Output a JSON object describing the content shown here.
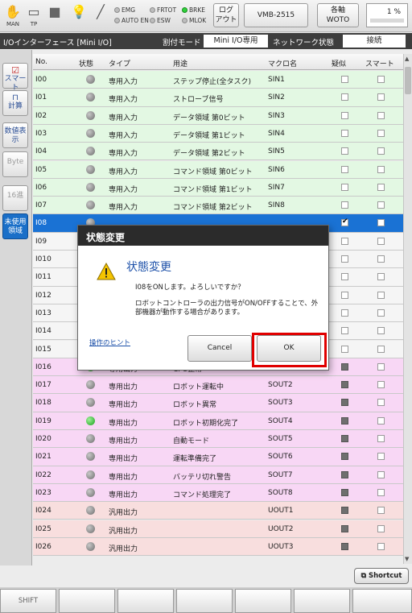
{
  "top_bar": {
    "icons": [
      {
        "name": "hand-icon",
        "label": "MAN"
      },
      {
        "name": "teach-pendant-icon",
        "label": "TP"
      },
      {
        "name": "stop-icon",
        "label": ""
      },
      {
        "name": "lightbulb-icon",
        "label": ""
      },
      {
        "name": "wrench-icon",
        "label": ""
      }
    ],
    "lamps": [
      {
        "label": "EMG",
        "on": false
      },
      {
        "label": "FRTOT",
        "on": false
      },
      {
        "label": "BRKE",
        "on": true
      },
      {
        "label": "AUTO EN",
        "on": false
      },
      {
        "label": "ESW",
        "on": false
      },
      {
        "label": "MLOK",
        "on": false
      }
    ],
    "log_button": {
      "line1": "ログ",
      "line2": "アウト"
    },
    "model": "VMB-2515",
    "axis_button": {
      "line1": "各軸",
      "line2": "WOTO"
    },
    "speed": "1 %"
  },
  "title_bar": {
    "title": "I/Oインターフェース [Mini I/O]",
    "assign_mode_label": "割付モード",
    "assign_mode_value": "Mini I/O専用",
    "network_label": "ネットワーク状態",
    "network_value": "接続"
  },
  "sidebar": {
    "items": [
      {
        "label": "スマート",
        "icon": "smart-check-icon"
      },
      {
        "label": "計算",
        "icon": "pulse-icon"
      },
      {
        "label": "数値表示",
        "icon": ""
      },
      {
        "label": "Byte",
        "icon": ""
      },
      {
        "label": "16進",
        "icon": ""
      },
      {
        "label": "未使用領域",
        "icon": ""
      }
    ]
  },
  "grid": {
    "headers": [
      "No.",
      "状態",
      "タイプ",
      "用途",
      "マクロ名",
      "疑似",
      "スマート"
    ],
    "rows": [
      {
        "no": "I00",
        "on": false,
        "type": "専用入力",
        "use": "ステップ停止(全タスク)",
        "macro": "SIN1",
        "group": "in",
        "sim": "empty",
        "smart": "empty"
      },
      {
        "no": "I01",
        "on": false,
        "type": "専用入力",
        "use": "ストローブ信号",
        "macro": "SIN2",
        "group": "in",
        "sim": "empty",
        "smart": "empty"
      },
      {
        "no": "I02",
        "on": false,
        "type": "専用入力",
        "use": "データ領域 第0ビット",
        "macro": "SIN3",
        "group": "in",
        "sim": "empty",
        "smart": "empty"
      },
      {
        "no": "I03",
        "on": false,
        "type": "専用入力",
        "use": "データ領域 第1ビット",
        "macro": "SIN4",
        "group": "in",
        "sim": "empty",
        "smart": "empty"
      },
      {
        "no": "I04",
        "on": false,
        "type": "専用入力",
        "use": "データ領域 第2ビット",
        "macro": "SIN5",
        "group": "in",
        "sim": "empty",
        "smart": "empty"
      },
      {
        "no": "I05",
        "on": false,
        "type": "専用入力",
        "use": "コマンド領域 第0ビット",
        "macro": "SIN6",
        "group": "in",
        "sim": "empty",
        "smart": "empty"
      },
      {
        "no": "I06",
        "on": false,
        "type": "専用入力",
        "use": "コマンド領域 第1ビット",
        "macro": "SIN7",
        "group": "in",
        "sim": "empty",
        "smart": "empty"
      },
      {
        "no": "I07",
        "on": false,
        "type": "専用入力",
        "use": "コマンド領域 第2ビット",
        "macro": "SIN8",
        "group": "in",
        "sim": "empty",
        "smart": "empty"
      },
      {
        "no": "I08",
        "on": false,
        "type": "",
        "use": "",
        "macro": "",
        "group": "sel",
        "sim": "checked",
        "smart": "empty"
      },
      {
        "no": "I09",
        "on": false,
        "type": "",
        "use": "",
        "macro": "",
        "group": "plain",
        "sim": "empty",
        "smart": "empty"
      },
      {
        "no": "I010",
        "on": false,
        "type": "",
        "use": "",
        "macro": "",
        "group": "plain",
        "sim": "empty",
        "smart": "empty"
      },
      {
        "no": "I011",
        "on": false,
        "type": "",
        "use": "",
        "macro": "",
        "group": "plain",
        "sim": "empty",
        "smart": "empty"
      },
      {
        "no": "I012",
        "on": false,
        "type": "",
        "use": "",
        "macro": "",
        "group": "plain",
        "sim": "empty",
        "smart": "empty"
      },
      {
        "no": "I013",
        "on": false,
        "type": "",
        "use": "",
        "macro": "",
        "group": "plain",
        "sim": "empty",
        "smart": "empty"
      },
      {
        "no": "I014",
        "on": false,
        "type": "",
        "use": "",
        "macro": "",
        "group": "plain",
        "sim": "empty",
        "smart": "empty"
      },
      {
        "no": "I015",
        "on": false,
        "type": "",
        "use": "",
        "macro": "",
        "group": "plain",
        "sim": "empty",
        "smart": "empty"
      },
      {
        "no": "I016",
        "on": true,
        "type": "専用出力",
        "use": "CPU正常",
        "macro": "SOUT1",
        "group": "out",
        "sim": "square",
        "smart": "empty"
      },
      {
        "no": "I017",
        "on": false,
        "type": "専用出力",
        "use": "ロボット運転中",
        "macro": "SOUT2",
        "group": "out",
        "sim": "square",
        "smart": "empty"
      },
      {
        "no": "I018",
        "on": false,
        "type": "専用出力",
        "use": "ロボット異常",
        "macro": "SOUT3",
        "group": "out",
        "sim": "square",
        "smart": "empty"
      },
      {
        "no": "I019",
        "on": true,
        "type": "専用出力",
        "use": "ロボット初期化完了",
        "macro": "SOUT4",
        "group": "out",
        "sim": "square",
        "smart": "empty"
      },
      {
        "no": "I020",
        "on": false,
        "type": "専用出力",
        "use": "自動モード",
        "macro": "SOUT5",
        "group": "out",
        "sim": "square",
        "smart": "empty"
      },
      {
        "no": "I021",
        "on": false,
        "type": "専用出力",
        "use": "運転準備完了",
        "macro": "SOUT6",
        "group": "out",
        "sim": "square",
        "smart": "empty"
      },
      {
        "no": "I022",
        "on": false,
        "type": "専用出力",
        "use": "バッテリ切れ警告",
        "macro": "SOUT7",
        "group": "out",
        "sim": "square",
        "smart": "empty"
      },
      {
        "no": "I023",
        "on": false,
        "type": "専用出力",
        "use": "コマンド処理完了",
        "macro": "SOUT8",
        "group": "out",
        "sim": "square",
        "smart": "empty"
      },
      {
        "no": "I024",
        "on": false,
        "type": "汎用出力",
        "use": "",
        "macro": "UOUT1",
        "group": "gen",
        "sim": "square",
        "smart": "empty"
      },
      {
        "no": "I025",
        "on": false,
        "type": "汎用出力",
        "use": "",
        "macro": "UOUT2",
        "group": "gen",
        "sim": "square",
        "smart": "empty"
      },
      {
        "no": "I026",
        "on": false,
        "type": "汎用出力",
        "use": "",
        "macro": "UOUT3",
        "group": "gen",
        "sim": "square",
        "smart": "empty"
      }
    ]
  },
  "dialog": {
    "title": "状態変更",
    "heading": "状態変更",
    "message1": "I08をONします。よろしいですか？",
    "message2": "ロボットコントローラの出力信号がON/OFFすることで、外部機器が動作する場合があります。",
    "hint_link": "操作のヒント",
    "cancel_label": "Cancel",
    "ok_label": "OK"
  },
  "bottom": {
    "shortcut_label": "Shortcut",
    "function_keys": [
      "SHIFT",
      "",
      "",
      "",
      "",
      "",
      "",
      ""
    ]
  },
  "colors": {
    "selection_blue": "#1a72d4",
    "input_row": "#e3f8e3",
    "output_row": "#f8d7f5",
    "general_row": "#f8dede",
    "highlight_red": "#e00000"
  }
}
